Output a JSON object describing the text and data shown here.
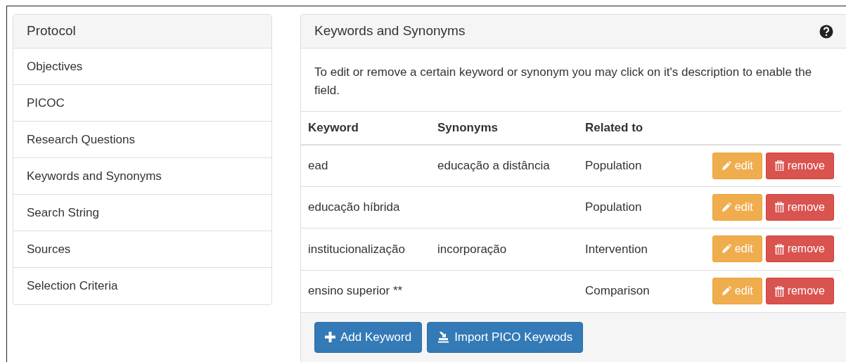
{
  "sidebar": {
    "title": "Protocol",
    "items": [
      {
        "label": "Objectives",
        "selected": false
      },
      {
        "label": "PICOC",
        "selected": false
      },
      {
        "label": "Research Questions",
        "selected": false
      },
      {
        "label": "Keywords and Synonyms",
        "selected": false
      },
      {
        "label": "Search String",
        "selected": false
      },
      {
        "label": "Sources",
        "selected": false
      },
      {
        "label": "Selection Criteria",
        "selected": false
      }
    ]
  },
  "panel": {
    "title": "Keywords and Synonyms",
    "help_text": "To edit or remove a certain keyword or synonym you may click on it's description to enable the field.",
    "table": {
      "columns": [
        "Keyword",
        "Synonyms",
        "Related to"
      ],
      "rows": [
        {
          "keyword": "ead",
          "synonyms": "educação a distância",
          "related_to": "Population",
          "actions": [
            "edit",
            "remove"
          ]
        },
        {
          "keyword": "educação híbrida",
          "related_to": "Population",
          "actions": [
            "edit",
            "remove"
          ]
        },
        {
          "keyword": "institucionalização",
          "synonyms": "incorporação",
          "related_to": "Intervention",
          "actions": [
            "edit",
            "remove"
          ]
        },
        {
          "keyword": "ensino superior **",
          "related_to": "Comparison",
          "actions": [
            "edit",
            "remove"
          ]
        }
      ]
    },
    "buttons": [
      "Add Keyword",
      "Import PICO Keywods"
    ]
  }
}
